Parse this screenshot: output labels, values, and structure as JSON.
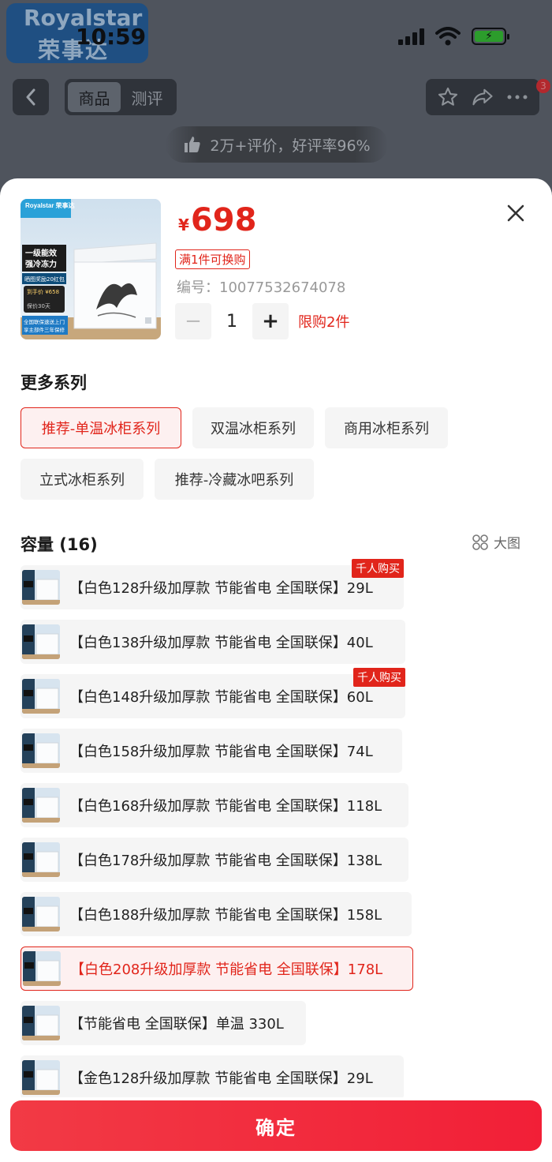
{
  "status_bar": {
    "time": "10:59"
  },
  "brand": {
    "en": "Royalstar",
    "cn": "荣事达"
  },
  "nav": {
    "tabs": [
      "商品",
      "测评"
    ],
    "badge_count": "3"
  },
  "rating": {
    "text": "2万+评价，好评率96%"
  },
  "product": {
    "currency": "¥",
    "price": "698",
    "tag": "满1件可换购",
    "sku": "编号：10077532674078",
    "quantity": "1",
    "minus": "−",
    "plus": "+",
    "limit": "限购2件",
    "image": {
      "brand": "Royalstar 荣事达",
      "badge_line1": "一级能效",
      "badge_line2": "强冷冻力",
      "sub": "晒图奖励20红包",
      "promo": "到手价 ¥658",
      "promo_note": "保价30天",
      "footer1": "全国联保速送上门",
      "footer2": "享主部件三年保修"
    }
  },
  "series": {
    "title": "更多系列",
    "items": [
      {
        "label": "推荐-单温冰柜系列",
        "selected": true
      },
      {
        "label": "双温冰柜系列",
        "selected": false
      },
      {
        "label": "商用冰柜系列",
        "selected": false
      },
      {
        "label": "立式冰柜系列",
        "selected": false
      },
      {
        "label": "推荐-冷藏冰吧系列",
        "selected": false
      }
    ]
  },
  "capacity": {
    "title": "容量 (16)",
    "big_view": "大图",
    "hot_label": "千人购买",
    "options": [
      {
        "label": "【白色128升级加厚款 节能省电 全国联保】29L",
        "hot": true,
        "selected": false
      },
      {
        "label": "【白色138升级加厚款 节能省电 全国联保】40L",
        "hot": false,
        "selected": false
      },
      {
        "label": "【白色148升级加厚款 节能省电 全国联保】60L",
        "hot": true,
        "selected": false
      },
      {
        "label": "【白色158升级加厚款 节能省电 全国联保】74L",
        "hot": false,
        "selected": false
      },
      {
        "label": "【白色168升级加厚款 节能省电 全国联保】118L",
        "hot": false,
        "selected": false
      },
      {
        "label": "【白色178升级加厚款 节能省电 全国联保】138L",
        "hot": false,
        "selected": false
      },
      {
        "label": "【白色188升级加厚款 节能省电 全国联保】158L",
        "hot": false,
        "selected": false
      },
      {
        "label": "【白色208升级加厚款 节能省电 全国联保】178L",
        "hot": false,
        "selected": true
      },
      {
        "label": "【节能省电 全国联保】单温 330L",
        "hot": false,
        "selected": false
      },
      {
        "label": "【金色128升级加厚款 节能省电 全国联保】29L",
        "hot": false,
        "selected": false
      }
    ]
  },
  "confirm": {
    "label": "确定"
  },
  "colors": {
    "accent": "#e1251b",
    "confirm": "#f22a3c",
    "chip_bg": "#f5f5f5"
  }
}
